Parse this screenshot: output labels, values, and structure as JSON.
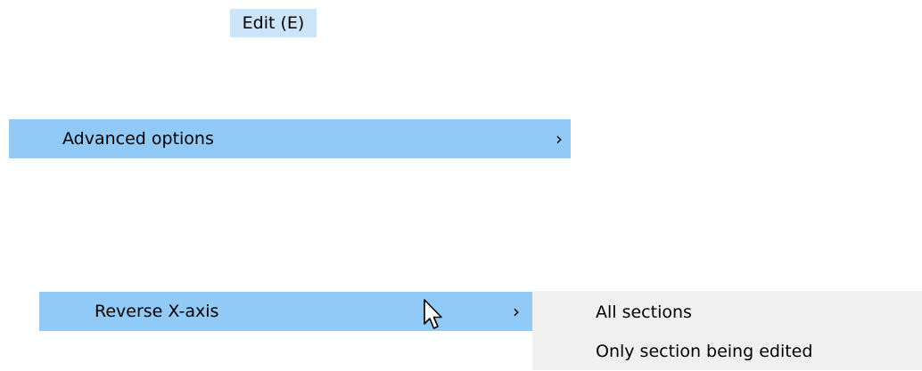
{
  "menu_bar": {
    "edit_label": "Edit (E)"
  },
  "edit_menu": {
    "advanced_options": {
      "label": "Advanced options",
      "chevron": "›"
    }
  },
  "advanced_menu": {
    "reverse_x_axis": {
      "label": "Reverse X-axis",
      "chevron": "›"
    }
  },
  "reverse_submenu": {
    "items": [
      {
        "label": "All sections"
      },
      {
        "label": "Only section being edited"
      }
    ]
  },
  "icons": {
    "submenu_indicator": "chevron-right-icon",
    "pointer": "mouse-pointer-icon"
  },
  "colors": {
    "menu_bar_highlight": "#cce4f7",
    "menu_item_highlight": "#91c9f7",
    "submenu_background": "#f0f0f0"
  }
}
